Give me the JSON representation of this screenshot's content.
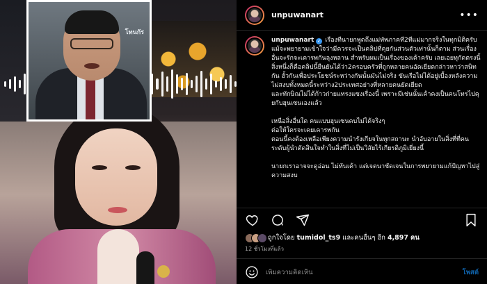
{
  "post": {
    "username": "unpuwanart",
    "caption_username": "unpuwanart",
    "caption_paragraphs": [
      "เรื่องที่นายกพูดถึงแม่ทัพภาคที่2ที่แม่มากจริงในทุกมิติครับ แม้จะพยายามเข้าใจว่ามีควรจะเป็นคลิปที่คุยกันส่วนตัวเท่านั้นก็ตาม ส่วนเรื่องอื่นจะรักจะเคารพกันลุงหลาน สำหรับผมเป็นเรื่องของเค้าครับ เลยเอยทุกัดตรงนี้ สิ่งหนึ่งก็คือคลิปนี้ยืนยันได้ว่า2ครอบครัวที่ถูกหลายคนอัดเยียดกล่าวหาว่าสนิทกัน ฮั้วกันเพื่อประโยชน์ระหว่างกันนั้นมันไม่จริง ขันเรีอไม่ได้อยู่เบื้องหลังความไม่สงบทั้งหมดนี้ระหว่าง2ประเทศอย่างที่หลายคนยัดเยียด\nและทักษิณไม่ได้ก้าวก่ายแทรงแซงเรื่องนี้ เพราะมีเช่นนั้นเค้าคงเป็นคนโทรไปคุยกับฮุนเซนเองแล้ว",
      "เหนือสิ่งอื่นใด คนแบบฮุนเซนคบไม่ได้จริงๆ\nต่อให้ใครจะเคยเคารพกัน\nตอนนี้คงต้องเหลือเพียงความนำรังเกียจในทุกสถานะ นำอับอายในสิ่งที่ที่คนระดับผู้นำตัดสินใจทำในสิ่งที่ไม่เป็นวิสัยไร้เกียรติภูมิเยี่ยงนี้",
      "นายกเราอาจจะดูอ่อน ไม่ทันเค้า แต่เจตนาชัดเจนในการพยายามแก้ปัญหาไปสู่ความสงบ"
    ],
    "liked_by_prefix": "ถูกใจโดย",
    "liked_by_user": "tumidol_ts9",
    "liked_by_suffix": "และคนอื่นๆ อีก",
    "like_count": "4,897",
    "like_unit": "คน",
    "timestamp": "12 ชั่วโมงที่แล้ว",
    "comment_placeholder": "เพิ่มความคิดเห็น",
    "post_label": "โพสต์"
  },
  "media": {
    "inset_logo": "โทนกัร"
  },
  "icons": {
    "like": "heart-icon",
    "comment": "comment-icon",
    "share": "share-icon",
    "save": "bookmark-icon",
    "more": "more-options-icon",
    "emoji": "emoji-icon",
    "verified": "verified-badge-icon"
  },
  "colors": {
    "verified": "#3897f0",
    "post_button": "#0f61a8",
    "muted_text": "#a8a8a8"
  }
}
